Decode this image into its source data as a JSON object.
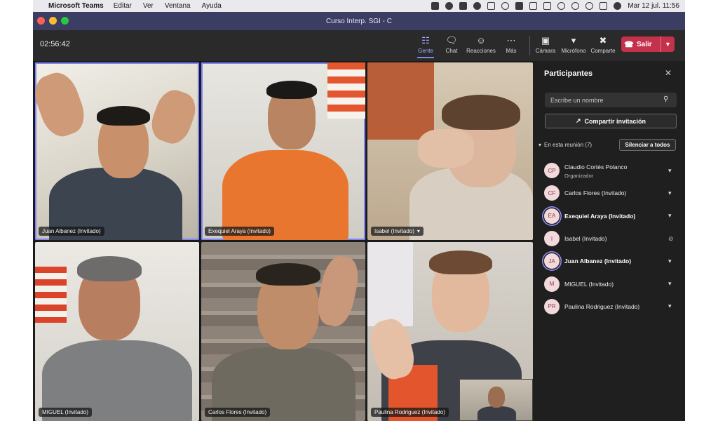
{
  "menubar": {
    "app_name": "Microsoft Teams",
    "menus": [
      "Editar",
      "Ver",
      "Ventana",
      "Ayuda"
    ],
    "clock": "Mar 12 jul.  11:56"
  },
  "window": {
    "title": "Curso Interp. SGI - C"
  },
  "meeting": {
    "timer": "02:56:42",
    "toolbar": {
      "people_label": "Gente",
      "chat_label": "Chat",
      "reactions_label": "Reacciones",
      "more_label": "Más",
      "camera_label": "Cámara",
      "mic_label": "Micrófono",
      "share_label": "Comparte",
      "leave_label": "Salir"
    }
  },
  "tiles": [
    {
      "name": "Juan Albanez (Invitado)"
    },
    {
      "name": "Exequiel Araya (Invitado)"
    },
    {
      "name": "Isabel (Invitado)"
    },
    {
      "name": "MIGUEL (Invitado)"
    },
    {
      "name": "Carlos Flores (Invitado)"
    },
    {
      "name": "Paulina Rodriguez (Invitado)"
    }
  ],
  "panel": {
    "title": "Participantes",
    "search_placeholder": "Escribe un nombre",
    "share_invite_label": "Compartir invitación",
    "section_label": "En esta reunión (7)",
    "mute_all_label": "Silenciar a todos",
    "participants": [
      {
        "initials": "CP",
        "name": "Claudio Cortés Polanco",
        "role": "Organizador"
      },
      {
        "initials": "CF",
        "name": "Carlos Flores (Invitado)"
      },
      {
        "initials": "EA",
        "name": "Exequiel Araya (Invitado)"
      },
      {
        "initials": "I",
        "name": "Isabel (Invitado)"
      },
      {
        "initials": "JA",
        "name": "Juan Albanez (Invitado)"
      },
      {
        "initials": "M",
        "name": "MIGUEL (Invitado)"
      },
      {
        "initials": "PR",
        "name": "Paulina Rodriguez (Invitado)"
      }
    ]
  }
}
